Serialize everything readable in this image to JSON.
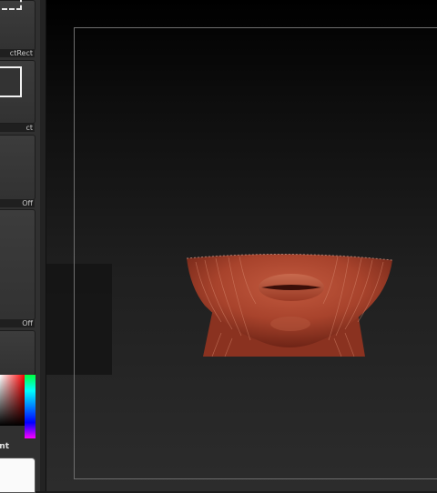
{
  "shelf": {
    "tools": [
      {
        "name": "marquee-select",
        "label": "ctRect",
        "icon": "marquee-icon"
      },
      {
        "name": "rect-select",
        "label": "ct",
        "icon": "rect-icon"
      },
      {
        "name": "toggle-a",
        "label": "Off"
      },
      {
        "name": "toggle-b",
        "label": "Off"
      }
    ],
    "color_picker": {
      "label": "nt"
    },
    "main_color": "#fafafa"
  },
  "viewport": {
    "background_top": "#000000",
    "background_bottom": "#2c2c2c",
    "model": {
      "name": "lower-face-mouth-mesh",
      "color": "#a8432c"
    }
  }
}
